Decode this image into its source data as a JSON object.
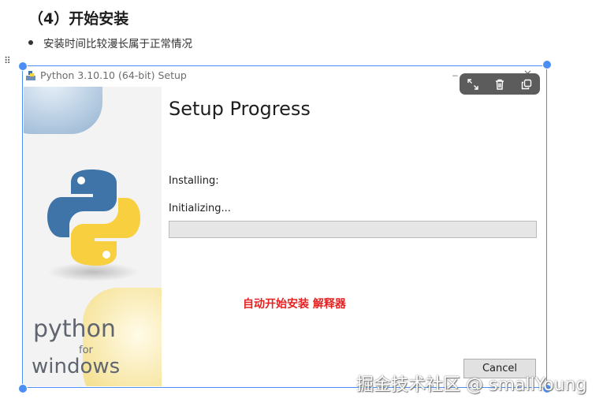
{
  "doc": {
    "heading": "（4）开始安装",
    "bullet": "安装时间比较漫长属于正常情况"
  },
  "drag_handle_glyph": "⠿",
  "window": {
    "title": "Python 3.10.10 (64-bit) Setup",
    "minimize_glyph": "–",
    "close_glyph": "✕"
  },
  "toolbar": {
    "icons": [
      "expand-icon",
      "trash-icon",
      "copy-icon"
    ]
  },
  "branding": {
    "word1": "python",
    "word2": "for",
    "word3": "windows"
  },
  "installer": {
    "title": "Setup Progress",
    "status_label": "Installing:",
    "step_label": "Initializing...",
    "progress_fraction": 0.0,
    "cancel_label": "Cancel"
  },
  "annotation": "自动开始安装 解释器",
  "watermark": "掘金技术社区 @ smallYoung",
  "colors": {
    "selection_frame": "#4b8ef5",
    "annotation": "#e52222",
    "python_blue": "#3f74a8",
    "python_yellow": "#f7cf3f",
    "progress_fill": "#06b025"
  }
}
